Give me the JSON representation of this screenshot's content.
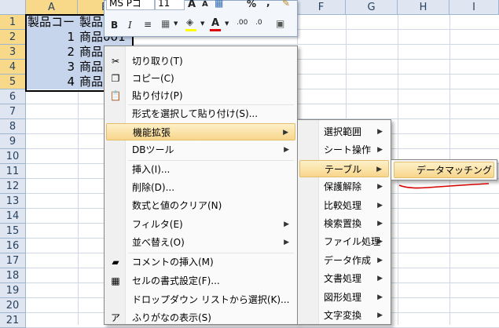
{
  "columns": [
    {
      "label": "A",
      "selected": true
    },
    {
      "label": "B",
      "selected": true
    },
    {
      "label": "F",
      "selected": false
    },
    {
      "label": "G",
      "selected": false
    },
    {
      "label": "H",
      "selected": false
    },
    {
      "label": "I",
      "selected": false
    }
  ],
  "rows": [
    "1",
    "2",
    "3",
    "4",
    "5",
    "6",
    "7",
    "8",
    "9",
    "10",
    "11",
    "12",
    "13",
    "14",
    "15",
    "16",
    "17",
    "18",
    "19",
    "20",
    "21"
  ],
  "cells": {
    "a1": "製品コード",
    "b1": "製品",
    "a2": "1",
    "b2": "商品001",
    "a3": "2",
    "b3": "商品",
    "a4": "3",
    "b4": "商品",
    "a5": "4",
    "b5": "商品"
  },
  "mini_toolbar": {
    "font_name": "MS Pゴ",
    "font_size": "11",
    "grow_font": "A",
    "shrink_font": "A",
    "percent": "%",
    "comma": ",",
    "bold": "B",
    "italic": "I",
    "font_color": "A"
  },
  "context_menu": {
    "items": [
      {
        "label": "切り取り(T)",
        "icon": "scissors-icon",
        "glyph": "✂"
      },
      {
        "label": "コピー(C)",
        "icon": "copy-icon",
        "glyph": "❐"
      },
      {
        "label": "貼り付け(P)",
        "icon": "paste-icon",
        "glyph": "📋"
      },
      {
        "label": "形式を選択して貼り付け(S)...",
        "icon": "",
        "glyph": ""
      },
      {
        "label": "機能拡張",
        "icon": "",
        "glyph": "",
        "submenu": true,
        "highlighted": true
      },
      {
        "label": "DBツール",
        "icon": "",
        "glyph": "",
        "submenu": true
      },
      {
        "label": "挿入(I)...",
        "icon": "",
        "glyph": ""
      },
      {
        "label": "削除(D)...",
        "icon": "",
        "glyph": ""
      },
      {
        "label": "数式と値のクリア(N)",
        "icon": "",
        "glyph": ""
      },
      {
        "label": "フィルタ(E)",
        "icon": "",
        "glyph": "",
        "submenu": true
      },
      {
        "label": "並べ替え(O)",
        "icon": "",
        "glyph": "",
        "submenu": true
      },
      {
        "label": "コメントの挿入(M)",
        "icon": "folder-icon",
        "glyph": "▰"
      },
      {
        "label": "セルの書式設定(F)...",
        "icon": "format-cells-icon",
        "glyph": "▦"
      },
      {
        "label": "ドロップダウン リストから選択(K)...",
        "icon": "",
        "glyph": ""
      },
      {
        "label": "ふりがなの表示(S)",
        "icon": "furigana-icon",
        "glyph": "ア"
      }
    ]
  },
  "extension_submenu": {
    "items": [
      {
        "label": "選択範囲"
      },
      {
        "label": "シート操作"
      },
      {
        "label": "テーブル",
        "highlighted": true
      },
      {
        "label": "保護解除"
      },
      {
        "label": "比較処理"
      },
      {
        "label": "検索置換"
      },
      {
        "label": "ファイル処理"
      },
      {
        "label": "データ作成"
      },
      {
        "label": "文書処理"
      },
      {
        "label": "図形処理"
      },
      {
        "label": "文字変換"
      }
    ]
  },
  "table_submenu": {
    "item": "データマッチング"
  },
  "submenu_arrow": "▶",
  "colors": {
    "highlight": "#f8d68c",
    "selection": "#c6d5ec",
    "annotation": "#d40000"
  }
}
